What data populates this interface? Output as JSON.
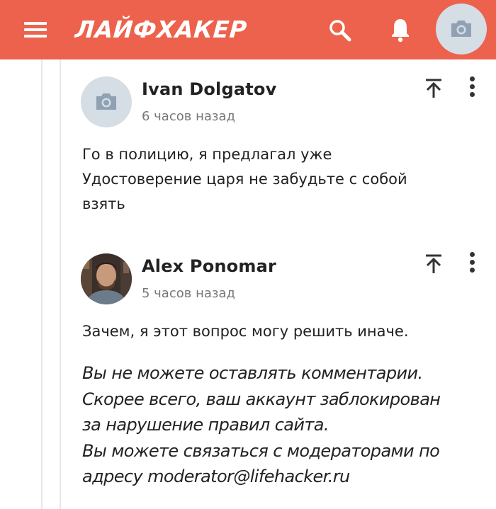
{
  "header": {
    "logo": "ЛАЙФХАКЕР",
    "background": "#ec624c",
    "icons": {
      "menu": "menu-icon",
      "search": "search-icon",
      "notifications": "bell-icon",
      "user": "camera-icon"
    }
  },
  "comments": [
    {
      "author": "Ivan Dolgatov",
      "time": "6 часов назад",
      "avatar": "camera-icon",
      "lines": [
        "Го в полицию, я предлагал уже",
        "Удостоверение царя не забудьте с собой",
        "взять"
      ]
    },
    {
      "author": "Alex Ponomar",
      "time": "5 часов назад",
      "avatar": "photo",
      "lines": [
        "Зачем, я этот вопрос могу решить иначе."
      ]
    }
  ],
  "notice": {
    "lines": [
      "Вы не можете оставлять комментарии.",
      "Скорее всего, ваш аккаунт заблокирован",
      "за нарушение правил сайта.",
      "Вы можете связаться с модераторами по",
      "адресу moderator@lifehacker.ru"
    ]
  }
}
